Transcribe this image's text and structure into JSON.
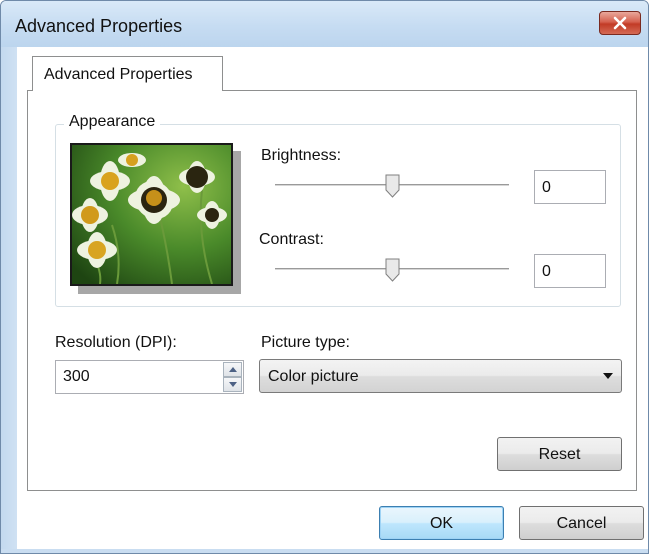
{
  "window": {
    "title": "Advanced Properties",
    "close_icon": "close-icon"
  },
  "tabs": [
    {
      "label": "Advanced Properties",
      "selected": true
    }
  ],
  "appearance": {
    "group_title": "Appearance",
    "preview_image": "flower-photo",
    "brightness": {
      "label": "Brightness:",
      "value": "0",
      "slider_fraction": 0.5
    },
    "contrast": {
      "label": "Contrast:",
      "value": "0",
      "slider_fraction": 0.5
    }
  },
  "resolution": {
    "label": "Resolution (DPI):",
    "value": "300"
  },
  "picture_type": {
    "label": "Picture type:",
    "selected": "Color picture"
  },
  "buttons": {
    "reset": "Reset",
    "ok": "OK",
    "cancel": "Cancel"
  },
  "colors": {
    "titlebar": "#c6dcf2",
    "close_button": "#c23b26",
    "default_button": "#bee6fd"
  }
}
